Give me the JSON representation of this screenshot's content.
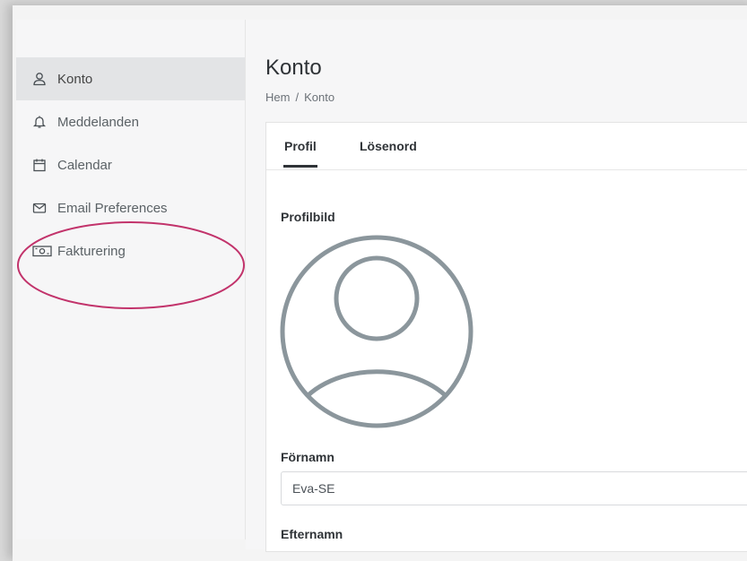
{
  "sidebar": {
    "items": [
      {
        "label": "Konto",
        "icon": "user-icon",
        "active": true
      },
      {
        "label": "Meddelanden",
        "icon": "bell-icon"
      },
      {
        "label": "Calendar",
        "icon": "calendar-icon"
      },
      {
        "label": "Email Preferences",
        "icon": "envelope-icon"
      },
      {
        "label": "Fakturering",
        "icon": "money-icon"
      }
    ]
  },
  "header": {
    "title": "Konto",
    "breadcrumb": [
      "Hem",
      "Konto"
    ],
    "breadcrumb_separator": "/"
  },
  "tabs": [
    {
      "label": "Profil",
      "active": true
    },
    {
      "label": "Lösenord"
    }
  ],
  "form": {
    "avatar_label": "Profilbild",
    "first_name_label": "Förnamn",
    "first_name_value": "Eva-SE",
    "last_name_label": "Efternamn"
  },
  "colors": {
    "annotation": "#c2336b",
    "avatar_stroke": "#8b969c",
    "active_item_bg": "#e3e4e6"
  }
}
